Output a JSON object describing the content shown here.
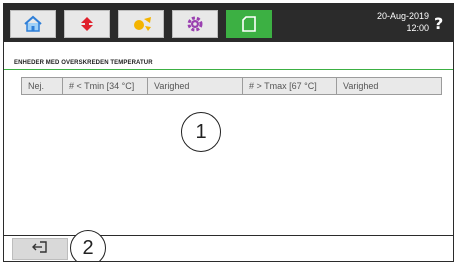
{
  "header": {
    "tabs": [
      {
        "icon": "home-icon",
        "active": false
      },
      {
        "icon": "temperature-arrows-icon",
        "active": false
      },
      {
        "icon": "sun-icon",
        "active": false
      },
      {
        "icon": "gear-icon",
        "active": false
      },
      {
        "icon": "page-icon",
        "active": true
      }
    ],
    "date": "20-Aug-2019",
    "time": "12:00",
    "help_label": "?"
  },
  "section": {
    "title": "ENHEDER MED OVERSKREDEN TEMPERATUR"
  },
  "table": {
    "columns": [
      "Nej.",
      "# < Tmin [34 °C]",
      "Varighed",
      "# > Tmax [67 °C]",
      "Varighed"
    ]
  },
  "callouts": {
    "one": "1",
    "two": "2"
  },
  "footer": {
    "back_icon": "exit-icon"
  },
  "colors": {
    "topbar": "#2b2b2b",
    "active_tab": "#3cb043",
    "accent_rule": "#3cb043"
  }
}
